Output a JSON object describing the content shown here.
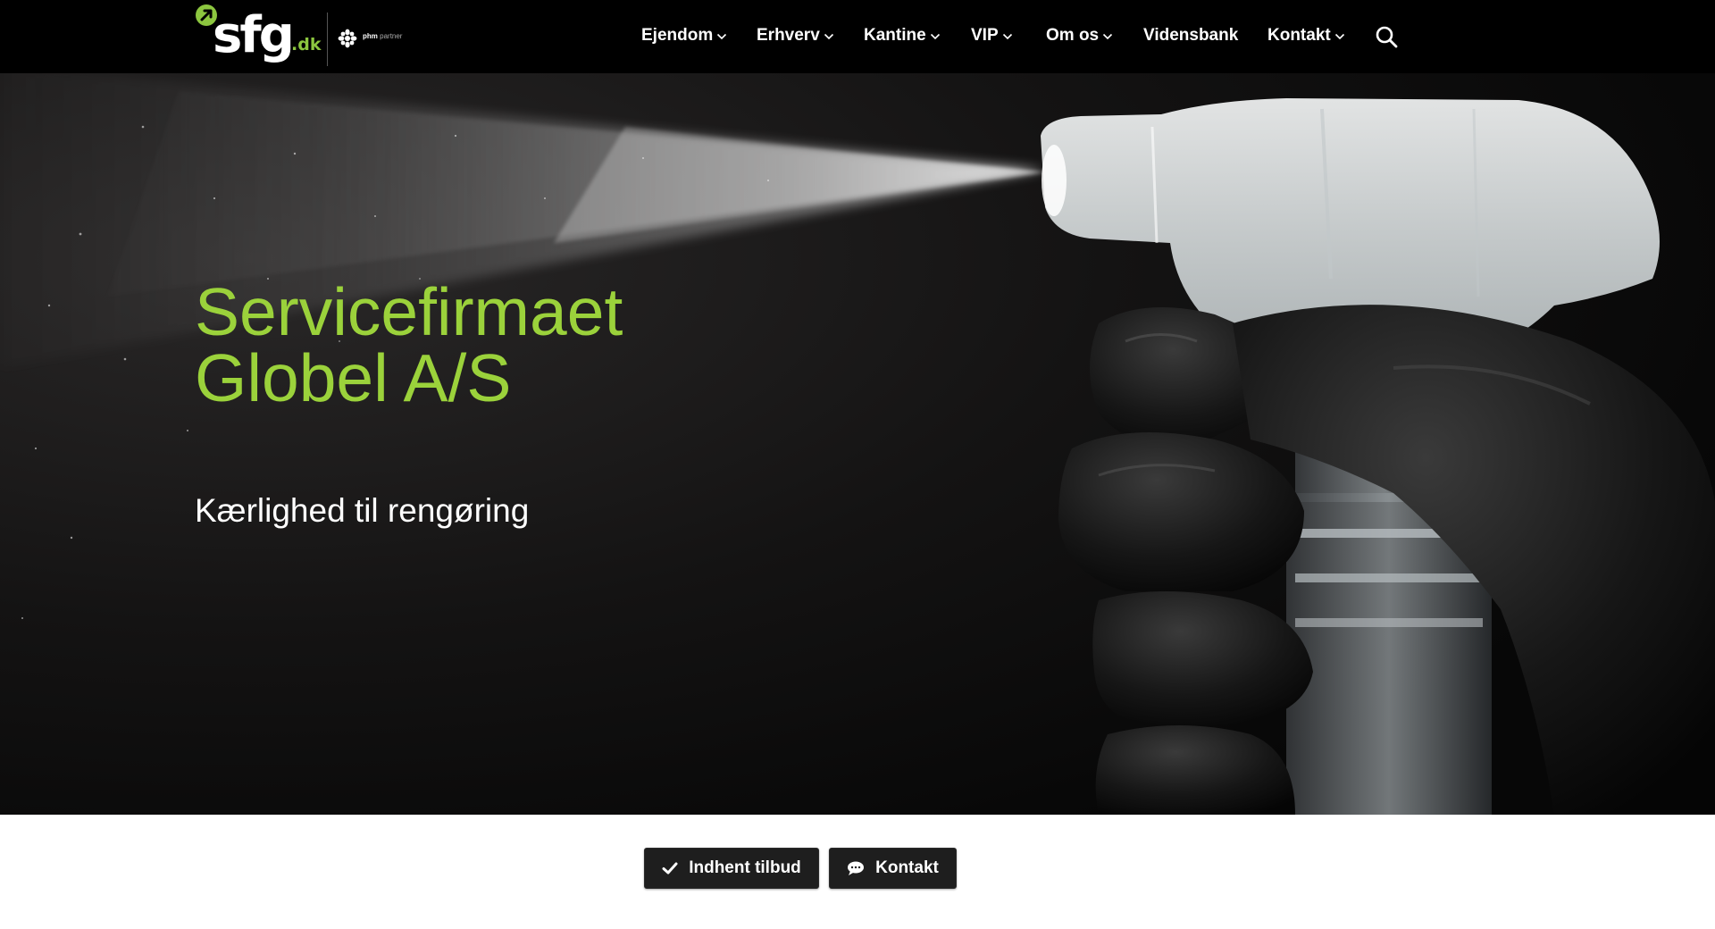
{
  "header": {
    "logo": {
      "word": "sfg",
      "suffix": ".dk",
      "partner_brand": "phm",
      "partner_text": "partner"
    },
    "nav": [
      {
        "label": "Ejendom",
        "dropdown": true
      },
      {
        "label": "Erhverv",
        "dropdown": true
      },
      {
        "label": "Kantine",
        "dropdown": true
      },
      {
        "label": "VIP",
        "dropdown": true
      },
      {
        "label": "Om os",
        "dropdown": true
      },
      {
        "label": "Vidensbank",
        "dropdown": false
      },
      {
        "label": "Kontakt",
        "dropdown": true
      }
    ],
    "search_icon": "search-icon"
  },
  "hero": {
    "title_line1": "Servicefirmaet",
    "title_line2": "Globel A/S",
    "subtitle": "Kærlighed til rengøring",
    "image": "spray-bottle-in-black-gloved-hand"
  },
  "actions": {
    "quote_label": "Indhent tilbud",
    "quote_icon": "check-icon",
    "contact_label": "Kontakt",
    "contact_icon": "chat-icon"
  },
  "colors": {
    "brand_green": "#8cc63f",
    "title_green": "#9bd23b",
    "header_bg": "#000000",
    "button_bg": "#1e1e1e"
  }
}
